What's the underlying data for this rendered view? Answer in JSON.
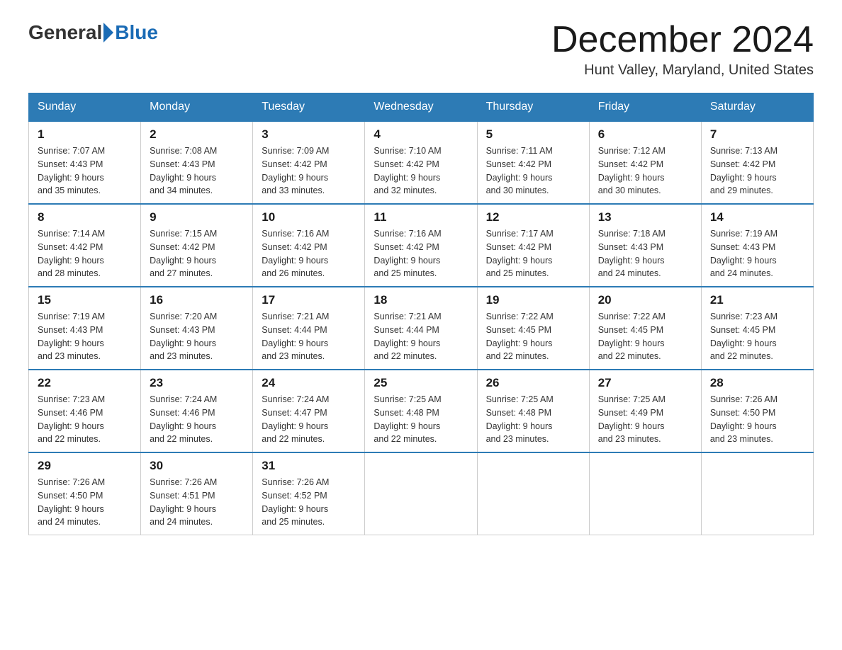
{
  "header": {
    "logo_general": "General",
    "logo_blue": "Blue",
    "month_title": "December 2024",
    "location": "Hunt Valley, Maryland, United States"
  },
  "weekdays": [
    "Sunday",
    "Monday",
    "Tuesday",
    "Wednesday",
    "Thursday",
    "Friday",
    "Saturday"
  ],
  "weeks": [
    [
      {
        "day": "1",
        "sunrise": "7:07 AM",
        "sunset": "4:43 PM",
        "daylight": "9 hours and 35 minutes."
      },
      {
        "day": "2",
        "sunrise": "7:08 AM",
        "sunset": "4:43 PM",
        "daylight": "9 hours and 34 minutes."
      },
      {
        "day": "3",
        "sunrise": "7:09 AM",
        "sunset": "4:42 PM",
        "daylight": "9 hours and 33 minutes."
      },
      {
        "day": "4",
        "sunrise": "7:10 AM",
        "sunset": "4:42 PM",
        "daylight": "9 hours and 32 minutes."
      },
      {
        "day": "5",
        "sunrise": "7:11 AM",
        "sunset": "4:42 PM",
        "daylight": "9 hours and 30 minutes."
      },
      {
        "day": "6",
        "sunrise": "7:12 AM",
        "sunset": "4:42 PM",
        "daylight": "9 hours and 30 minutes."
      },
      {
        "day": "7",
        "sunrise": "7:13 AM",
        "sunset": "4:42 PM",
        "daylight": "9 hours and 29 minutes."
      }
    ],
    [
      {
        "day": "8",
        "sunrise": "7:14 AM",
        "sunset": "4:42 PM",
        "daylight": "9 hours and 28 minutes."
      },
      {
        "day": "9",
        "sunrise": "7:15 AM",
        "sunset": "4:42 PM",
        "daylight": "9 hours and 27 minutes."
      },
      {
        "day": "10",
        "sunrise": "7:16 AM",
        "sunset": "4:42 PM",
        "daylight": "9 hours and 26 minutes."
      },
      {
        "day": "11",
        "sunrise": "7:16 AM",
        "sunset": "4:42 PM",
        "daylight": "9 hours and 25 minutes."
      },
      {
        "day": "12",
        "sunrise": "7:17 AM",
        "sunset": "4:42 PM",
        "daylight": "9 hours and 25 minutes."
      },
      {
        "day": "13",
        "sunrise": "7:18 AM",
        "sunset": "4:43 PM",
        "daylight": "9 hours and 24 minutes."
      },
      {
        "day": "14",
        "sunrise": "7:19 AM",
        "sunset": "4:43 PM",
        "daylight": "9 hours and 24 minutes."
      }
    ],
    [
      {
        "day": "15",
        "sunrise": "7:19 AM",
        "sunset": "4:43 PM",
        "daylight": "9 hours and 23 minutes."
      },
      {
        "day": "16",
        "sunrise": "7:20 AM",
        "sunset": "4:43 PM",
        "daylight": "9 hours and 23 minutes."
      },
      {
        "day": "17",
        "sunrise": "7:21 AM",
        "sunset": "4:44 PM",
        "daylight": "9 hours and 23 minutes."
      },
      {
        "day": "18",
        "sunrise": "7:21 AM",
        "sunset": "4:44 PM",
        "daylight": "9 hours and 22 minutes."
      },
      {
        "day": "19",
        "sunrise": "7:22 AM",
        "sunset": "4:45 PM",
        "daylight": "9 hours and 22 minutes."
      },
      {
        "day": "20",
        "sunrise": "7:22 AM",
        "sunset": "4:45 PM",
        "daylight": "9 hours and 22 minutes."
      },
      {
        "day": "21",
        "sunrise": "7:23 AM",
        "sunset": "4:45 PM",
        "daylight": "9 hours and 22 minutes."
      }
    ],
    [
      {
        "day": "22",
        "sunrise": "7:23 AM",
        "sunset": "4:46 PM",
        "daylight": "9 hours and 22 minutes."
      },
      {
        "day": "23",
        "sunrise": "7:24 AM",
        "sunset": "4:46 PM",
        "daylight": "9 hours and 22 minutes."
      },
      {
        "day": "24",
        "sunrise": "7:24 AM",
        "sunset": "4:47 PM",
        "daylight": "9 hours and 22 minutes."
      },
      {
        "day": "25",
        "sunrise": "7:25 AM",
        "sunset": "4:48 PM",
        "daylight": "9 hours and 22 minutes."
      },
      {
        "day": "26",
        "sunrise": "7:25 AM",
        "sunset": "4:48 PM",
        "daylight": "9 hours and 23 minutes."
      },
      {
        "day": "27",
        "sunrise": "7:25 AM",
        "sunset": "4:49 PM",
        "daylight": "9 hours and 23 minutes."
      },
      {
        "day": "28",
        "sunrise": "7:26 AM",
        "sunset": "4:50 PM",
        "daylight": "9 hours and 23 minutes."
      }
    ],
    [
      {
        "day": "29",
        "sunrise": "7:26 AM",
        "sunset": "4:50 PM",
        "daylight": "9 hours and 24 minutes."
      },
      {
        "day": "30",
        "sunrise": "7:26 AM",
        "sunset": "4:51 PM",
        "daylight": "9 hours and 24 minutes."
      },
      {
        "day": "31",
        "sunrise": "7:26 AM",
        "sunset": "4:52 PM",
        "daylight": "9 hours and 25 minutes."
      },
      null,
      null,
      null,
      null
    ]
  ]
}
